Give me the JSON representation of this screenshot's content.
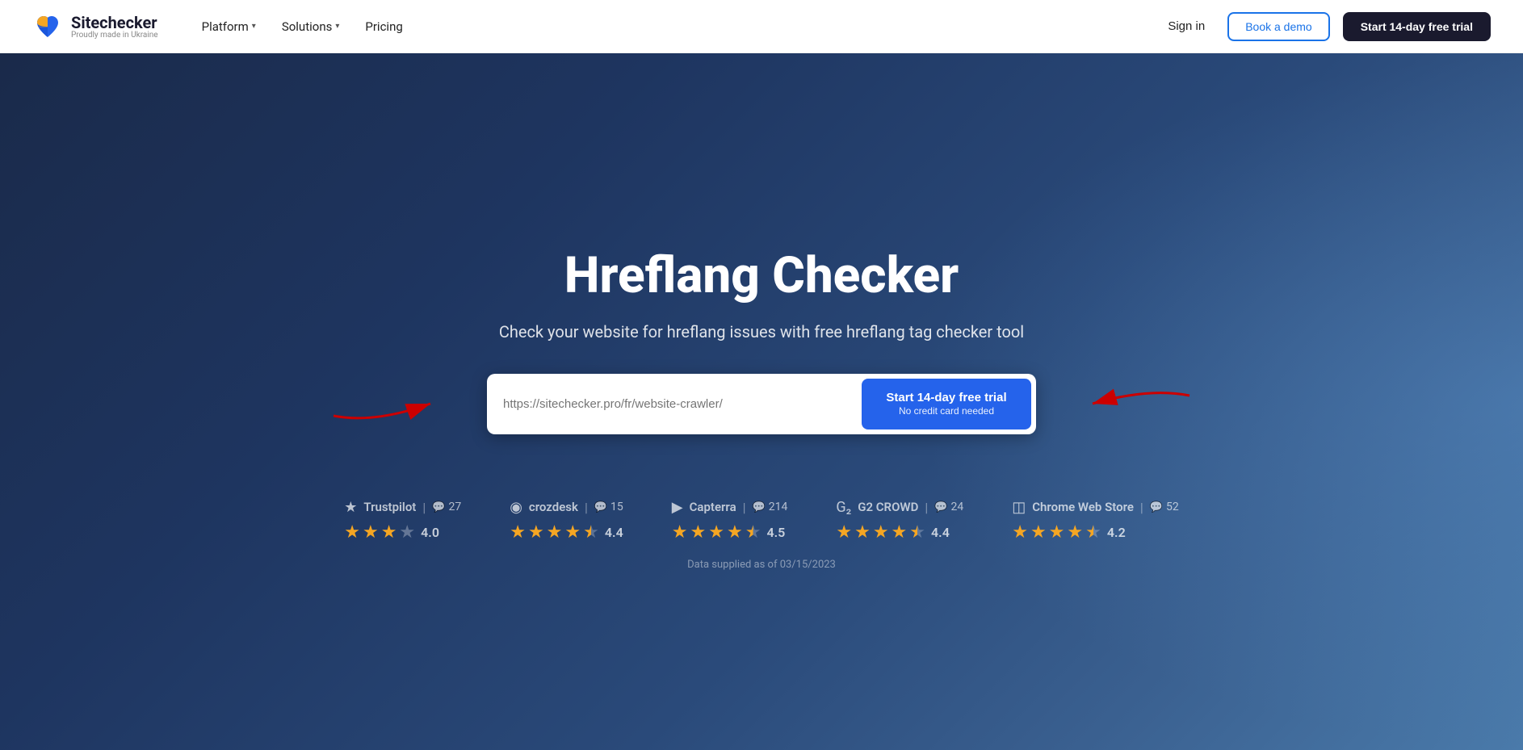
{
  "brand": {
    "name": "Sitechecker",
    "tagline": "Proudly made in Ukraine"
  },
  "nav": {
    "platform_label": "Platform",
    "solutions_label": "Solutions",
    "pricing_label": "Pricing",
    "signin_label": "Sign in",
    "book_demo_label": "Book a demo",
    "trial_label": "Start 14-day free trial"
  },
  "hero": {
    "title": "Hreflang Checker",
    "subtitle": "Check your website for hreflang issues with free hreflang tag checker tool",
    "input_placeholder": "https://sitechecker.pro/fr/website-crawler/",
    "cta_label": "Start 14-day free trial",
    "cta_sub": "No credit card needed"
  },
  "ratings": [
    {
      "name": "Trustpilot",
      "count": "27",
      "value": "4.0",
      "full_stars": 3,
      "half_stars": 0,
      "empty_stars": 1
    },
    {
      "name": "crozdesk",
      "count": "15",
      "value": "4.4",
      "full_stars": 4,
      "half_stars": 1,
      "empty_stars": 0
    },
    {
      "name": "Capterra",
      "count": "214",
      "value": "4.5",
      "full_stars": 4,
      "half_stars": 1,
      "empty_stars": 0
    },
    {
      "name": "G2 CROWD",
      "count": "24",
      "value": "4.4",
      "full_stars": 4,
      "half_stars": 1,
      "empty_stars": 0
    },
    {
      "name": "Chrome Web Store",
      "count": "52",
      "value": "4.2",
      "full_stars": 4,
      "half_stars": 1,
      "empty_stars": 0
    }
  ],
  "data_supplied_label": "Data supplied as of 03/15/2023"
}
